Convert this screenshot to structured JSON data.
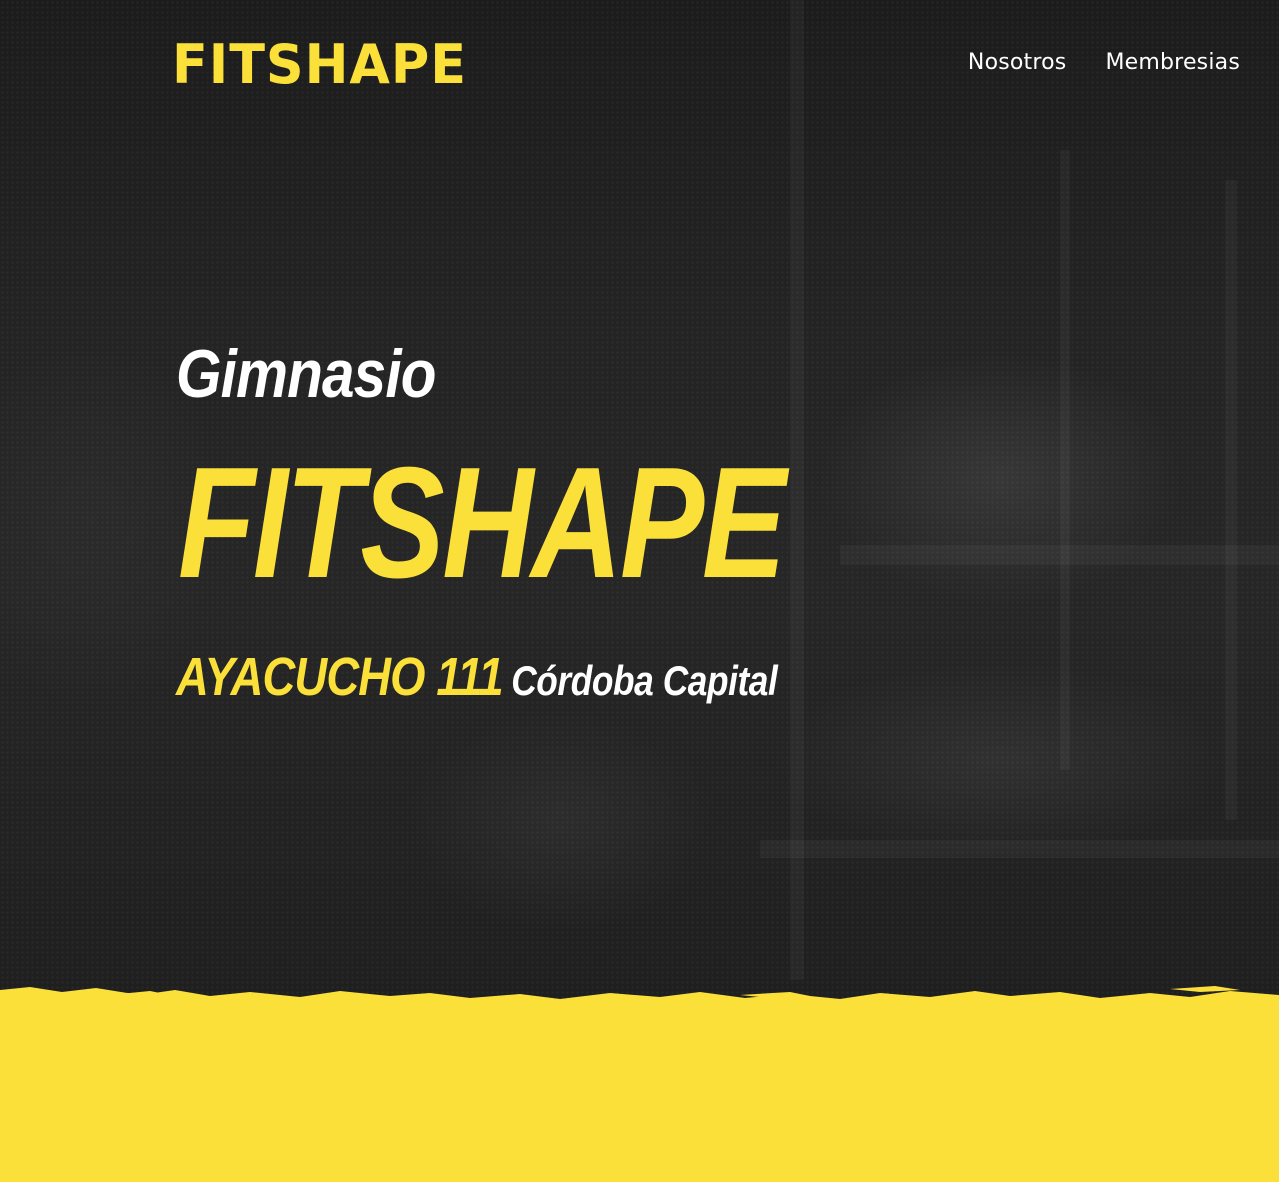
{
  "header": {
    "logo_text": "FITSHAPE",
    "nav": [
      {
        "label": "Nosotros"
      },
      {
        "label": "Membresias"
      }
    ]
  },
  "hero": {
    "subtitle": "Gimnasio",
    "title": "FITSHAPE",
    "address_street": "AYACUCHO 111",
    "address_city": "Córdoba Capital"
  },
  "colors": {
    "accent": "#fbe03a",
    "background_dark": "#222222",
    "text_light": "#ffffff"
  }
}
